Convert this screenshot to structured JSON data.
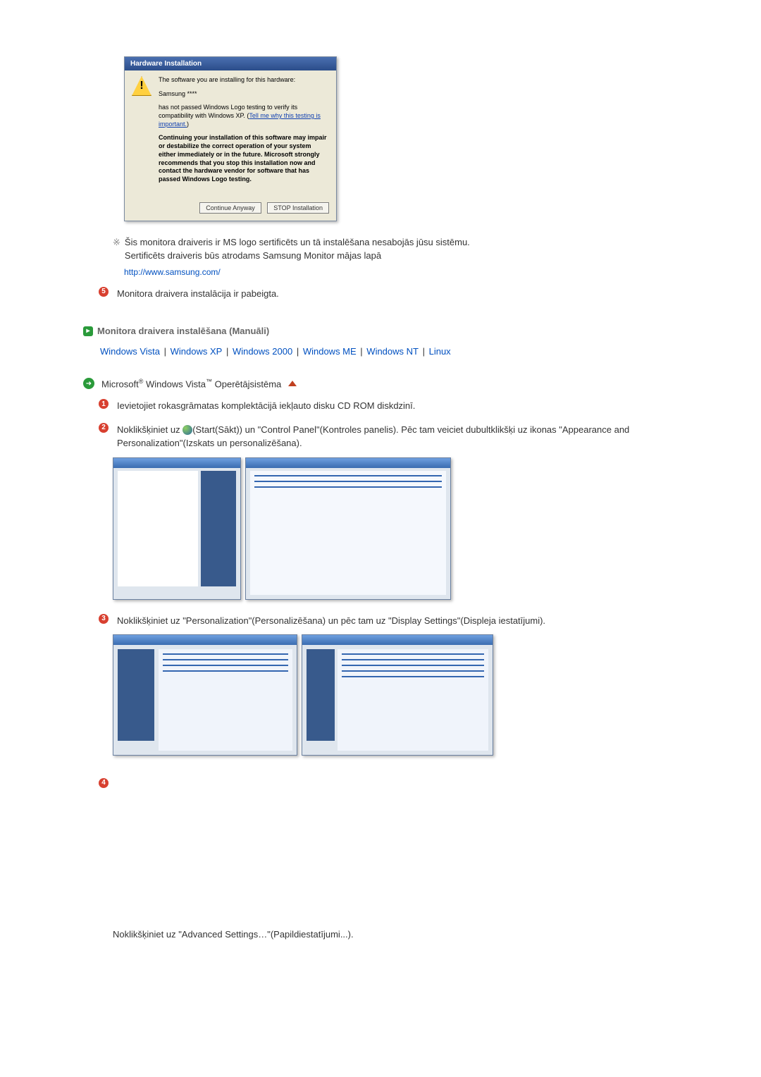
{
  "dialog": {
    "title": "Hardware Installation",
    "line1": "The software you are installing for this hardware:",
    "device": "Samsung ****",
    "line2a": "has not passed Windows Logo testing to verify its compatibility with Windows XP. (",
    "link": "Tell me why this testing is important.",
    "line2b": ")",
    "warn": "Continuing your installation of this software may impair or destabilize the correct operation of your system either immediately or in the future. Microsoft strongly recommends that you stop this installation now and contact the hardware vendor for software that has passed Windows Logo testing.",
    "btn_continue": "Continue Anyway",
    "btn_stop": "STOP Installation"
  },
  "note": {
    "line1": "Šis monitora draiveris ir MS logo sertificēts un tā instalēšana nesabojās jūsu sistēmu.",
    "line2": "Sertificēts draiveris būs atrodams Samsung Monitor mājas lapā",
    "url": "http://www.samsung.com/"
  },
  "step5": {
    "num": "5",
    "text": "Monitora draivera instalācija ir pabeigta."
  },
  "section_title": "Monitora draivera instalēšana (Manuāli)",
  "os_links": {
    "vista": "Windows Vista",
    "xp": "Windows XP",
    "w2000": "Windows 2000",
    "me": "Windows ME",
    "nt": "Windows NT",
    "linux": "Linux",
    "sep": " | "
  },
  "os_heading": {
    "pre": "Microsoft",
    "reg": "®",
    "mid": " Windows Vista",
    "tm": "™",
    "post": " Operētājsistēma"
  },
  "step1": {
    "num": "1",
    "text": "Ievietojiet rokasgrāmatas komplektācijā iekļauto disku CD ROM diskdzinī."
  },
  "step2": {
    "num": "2",
    "textA": "Noklikšķiniet uz ",
    "textB": "(Start(Sākt)) un \"Control Panel\"(Kontroles panelis). Pēc tam veiciet dubultklikšķi uz ikonas \"Appearance and Personalization\"(Izskats un personalizēšana)."
  },
  "step3": {
    "num": "3",
    "text": "Noklikšķiniet uz \"Personalization\"(Personalizēšana) un pēc tam uz \"Display Settings\"(Displeja iestatījumi)."
  },
  "step4": {
    "num": "4",
    "text": "Noklikšķiniet uz \"Advanced Settings…\"(Papildiestatījumi...)."
  }
}
